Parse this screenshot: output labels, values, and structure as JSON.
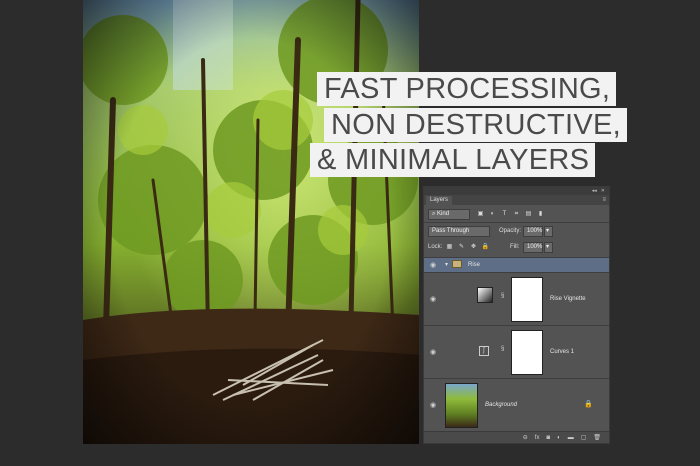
{
  "headline": {
    "line1": "FAST PROCESSING,",
    "line2": "NON DESTRUCTIVE,",
    "line3": "& MINIMAL LAYERS"
  },
  "layers_panel": {
    "tab": "Layers",
    "filter_kind": "Kind",
    "blend_mode": "Pass Through",
    "opacity_label": "Opacity:",
    "opacity_value": "100%",
    "lock_label": "Lock:",
    "fill_label": "Fill:",
    "fill_value": "100%",
    "group_name": "Rise",
    "layers": [
      {
        "name": "Rise Vignette",
        "icon": "gradient-icon"
      },
      {
        "name": "Curves 1",
        "icon": "curves-icon"
      },
      {
        "name": "Background",
        "icon": "photo-thumbnail"
      }
    ],
    "bottom_icons": [
      "link-icon",
      "fx-icon",
      "mask-icon",
      "adjustment-icon",
      "folder-icon",
      "new-layer-icon",
      "trash-icon"
    ]
  },
  "colors": {
    "background": "#2c2c2c",
    "panel": "#535353",
    "selected_row": "#5d6e86",
    "headline_bg": "#f2f2f2",
    "headline_text": "#4a4a4a"
  }
}
